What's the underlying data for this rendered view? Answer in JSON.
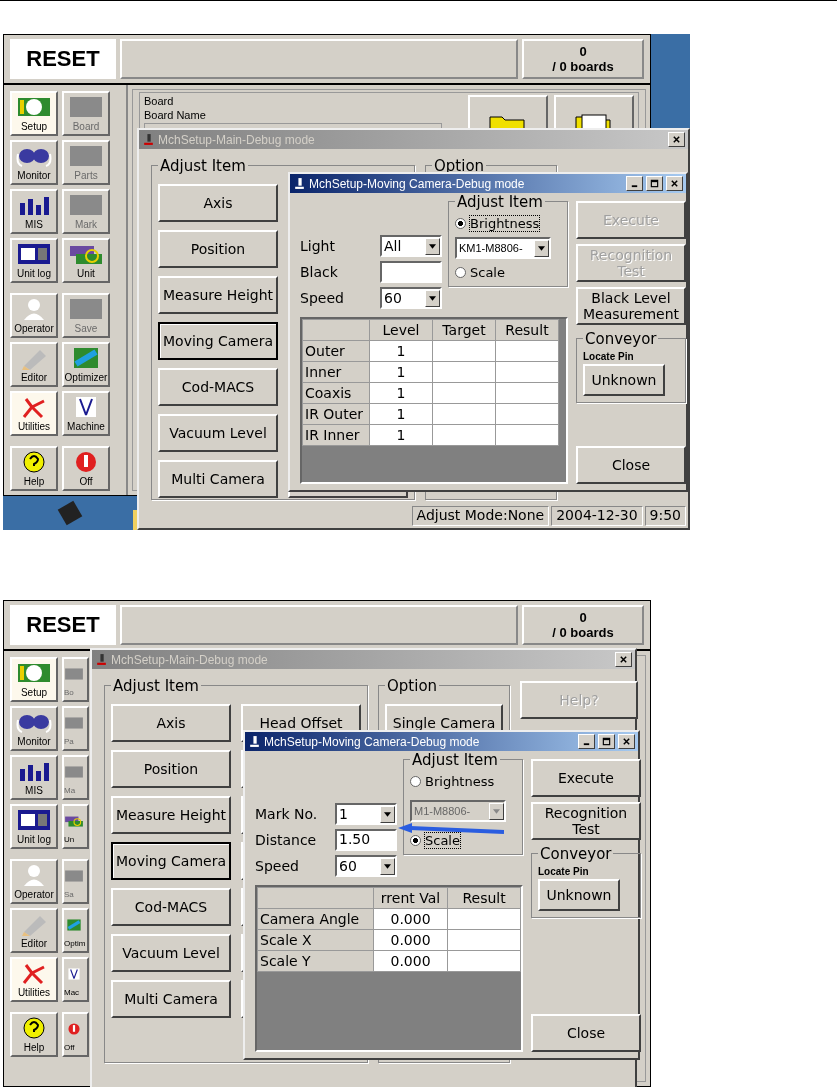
{
  "shots": [
    {
      "app": {
        "reset": "RESET",
        "count": "0",
        "boards": "/ 0 boards",
        "sidebar_cut": false,
        "sidebar": [
          {
            "label": "Setup",
            "selected": true,
            "disabled": false
          },
          {
            "label": "Board",
            "selected": false,
            "disabled": true
          },
          {
            "label": "Monitor",
            "selected": false,
            "disabled": false
          },
          {
            "label": "Parts",
            "selected": false,
            "disabled": true
          },
          {
            "label": "MIS",
            "selected": false,
            "disabled": false
          },
          {
            "label": "Mark",
            "selected": false,
            "disabled": true
          },
          {
            "label": "Unit log",
            "selected": false,
            "disabled": false
          },
          {
            "label": "Unit",
            "selected": false,
            "disabled": false
          },
          {
            "label": "Operator",
            "selected": false,
            "disabled": false
          },
          {
            "label": "Save",
            "selected": false,
            "disabled": true
          },
          {
            "label": "Editor",
            "selected": false,
            "disabled": false
          },
          {
            "label": "Optimizer",
            "selected": false,
            "disabled": false
          },
          {
            "label": "Utilities",
            "selected": true,
            "disabled": false
          },
          {
            "label": "Machine",
            "selected": false,
            "disabled": false
          },
          {
            "label": "Help",
            "selected": false,
            "disabled": false
          },
          {
            "label": "Off",
            "selected": false,
            "disabled": false
          }
        ],
        "board_group": {
          "title": "Board",
          "label": "Board Name"
        }
      },
      "main": {
        "title": "MchSetup-Main-Debug mode",
        "adjust_title": "Adjust Item",
        "adjust_items": [
          {
            "label": "Axis",
            "selected": false
          },
          {
            "label": "Position",
            "selected": false
          },
          {
            "label": "Measure Height",
            "selected": false
          },
          {
            "label": "Moving Camera",
            "selected": true
          },
          {
            "label": "Cod-MACS",
            "selected": false
          },
          {
            "label": "Vacuum Level",
            "selected": false
          },
          {
            "label": "Multi Camera",
            "selected": false
          }
        ],
        "option_title": "Option",
        "status": [
          "Adjust Mode:None",
          "2004-12-30",
          "9:50"
        ]
      },
      "sub": {
        "title": "MchSetup-Moving Camera-Debug mode",
        "fields": [
          {
            "label": "Light",
            "kind": "dropdown",
            "value": "All"
          },
          {
            "label": "Black",
            "kind": "text"
          },
          {
            "label": "Speed",
            "kind": "dropdown",
            "value": "60"
          }
        ],
        "adjust": {
          "title": "Adjust Item",
          "radios": [
            {
              "label": "Brightness",
              "selected": true
            },
            {
              "label": "Scale",
              "selected": false
            }
          ],
          "dropdown": {
            "value": "KM1-M8806-",
            "disabled": false
          }
        },
        "table": {
          "columns": [
            "",
            "Level",
            "Target",
            "Result"
          ],
          "rows": [
            {
              "cells": [
                "Outer",
                "1"
              ]
            },
            {
              "cells": [
                "Inner",
                "1"
              ]
            },
            {
              "cells": [
                "Coaxis",
                "1"
              ]
            },
            {
              "cells": [
                "IR Outer",
                "1"
              ]
            },
            {
              "cells": [
                "IR Inner",
                "1"
              ]
            }
          ]
        },
        "buttons": [
          {
            "label": "Execute",
            "disabled": true
          },
          {
            "label": "Recognition Test",
            "disabled": true
          },
          {
            "label": "Black Level Measurement",
            "disabled": false
          }
        ],
        "conveyor": {
          "title": "Conveyor",
          "label": "Locate Pin",
          "button": "Unknown"
        },
        "close": "Close"
      }
    },
    {
      "app": {
        "reset": "RESET",
        "count": "0",
        "boards": "/ 0 boards",
        "sidebar_cut": true,
        "sidebar": [
          {
            "label": "Setup",
            "selected": true,
            "disabled": false
          },
          {
            "label": "Bo",
            "selected": false,
            "disabled": true
          },
          {
            "label": "Monitor",
            "selected": false,
            "disabled": false
          },
          {
            "label": "Pa",
            "selected": false,
            "disabled": true
          },
          {
            "label": "MIS",
            "selected": false,
            "disabled": false
          },
          {
            "label": "Ma",
            "selected": false,
            "disabled": true
          },
          {
            "label": "Unit log",
            "selected": false,
            "disabled": false
          },
          {
            "label": "Un",
            "selected": false,
            "disabled": false
          },
          {
            "label": "Operator",
            "selected": false,
            "disabled": false
          },
          {
            "label": "Sa",
            "selected": false,
            "disabled": true
          },
          {
            "label": "Editor",
            "selected": false,
            "disabled": false
          },
          {
            "label": "Optim",
            "selected": false,
            "disabled": false
          },
          {
            "label": "Utilities",
            "selected": true,
            "disabled": false
          },
          {
            "label": "Mac",
            "selected": false,
            "disabled": false
          },
          {
            "label": "Help",
            "selected": false,
            "disabled": false
          },
          {
            "label": "Off",
            "selected": false,
            "disabled": false
          }
        ]
      },
      "main": {
        "title": "MchSetup-Main-Debug mode",
        "adjust_title": "Adjust Item",
        "adjust_items": [
          {
            "label": "Axis",
            "selected": false
          },
          {
            "label": "Position",
            "selected": false
          },
          {
            "label": "Measure Height",
            "selected": false
          },
          {
            "label": "Moving Camera",
            "selected": true
          },
          {
            "label": "Cod-MACS",
            "selected": false
          },
          {
            "label": "Vacuum Level",
            "selected": false
          },
          {
            "label": "Multi Camera",
            "selected": false
          }
        ],
        "second_column": [
          "Head Offset"
        ],
        "option_title": "Option",
        "option_button": "Single Camera",
        "help": {
          "label": "Help?",
          "disabled": true
        }
      },
      "sub": {
        "title": "MchSetup-Moving Camera-Debug mode",
        "fields": [
          {
            "label": "Mark No.",
            "kind": "dropdown",
            "value": "1"
          },
          {
            "label": "Distance",
            "kind": "text",
            "value": "1.50"
          },
          {
            "label": "Speed",
            "kind": "dropdown",
            "value": "60"
          }
        ],
        "adjust": {
          "title": "Adjust Item",
          "radios": [
            {
              "label": "Brightness",
              "selected": false
            },
            {
              "label": "Scale",
              "selected": true
            }
          ],
          "dropdown": {
            "value": "M1-M8806-",
            "disabled": true
          }
        },
        "table": {
          "columns": [
            "",
            "rrent Val",
            "Result"
          ],
          "rows": [
            {
              "cells": [
                "Camera Angle",
                "0.000"
              ]
            },
            {
              "cells": [
                "Scale X",
                "0.000"
              ]
            },
            {
              "cells": [
                "Scale Y",
                "0.000"
              ]
            }
          ]
        },
        "buttons": [
          {
            "label": "Execute",
            "disabled": false
          },
          {
            "label": "Recognition Test",
            "disabled": false
          }
        ],
        "conveyor": {
          "title": "Conveyor",
          "label": "Locate Pin",
          "button": "Unknown"
        },
        "close": "Close"
      }
    }
  ]
}
